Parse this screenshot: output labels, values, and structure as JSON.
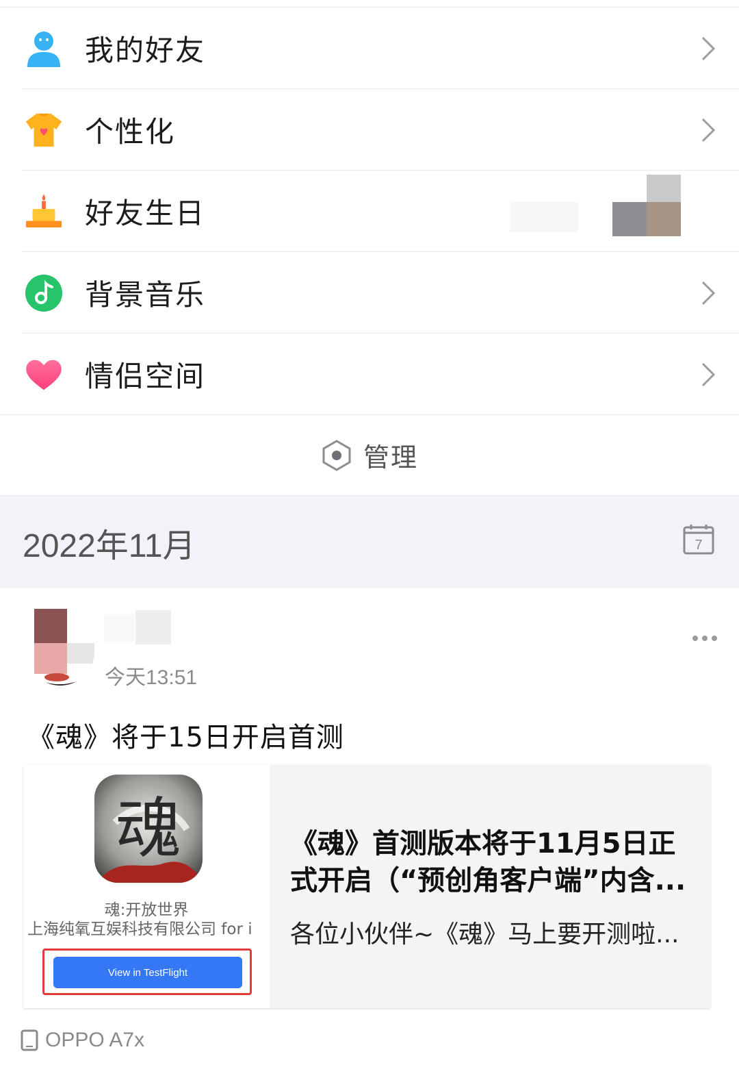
{
  "menu": {
    "items": [
      {
        "label": "我的好友",
        "icon": "friends-icon"
      },
      {
        "label": "个性化",
        "icon": "tshirt-icon"
      },
      {
        "label": "好友生日",
        "icon": "cake-icon"
      },
      {
        "label": "背景音乐",
        "icon": "music-note-icon"
      },
      {
        "label": "情侣空间",
        "icon": "heart-icon"
      }
    ],
    "manage_label": "管理"
  },
  "timeline": {
    "month": "2022年11月",
    "calendar_day": "7"
  },
  "post": {
    "time": "今天13:51",
    "title": "《魂》将于15日开启首测",
    "card": {
      "app_icon_glyph": "魂",
      "app_name": "魂:开放世界",
      "company": "上海纯氧互娱科技有限公司 for i",
      "button_label": "View in TestFlight",
      "title": "《魂》首测版本将于11月5日正式开启（“预创角客户端”内含...",
      "description": "各位小伙伴~《魂》马上要开测啦..."
    },
    "device": "OPPO A7x"
  },
  "colors": {
    "accent_blue": "#3478f6",
    "highlight_red": "#e03a3a",
    "month_bg": "#f2f3f8"
  }
}
